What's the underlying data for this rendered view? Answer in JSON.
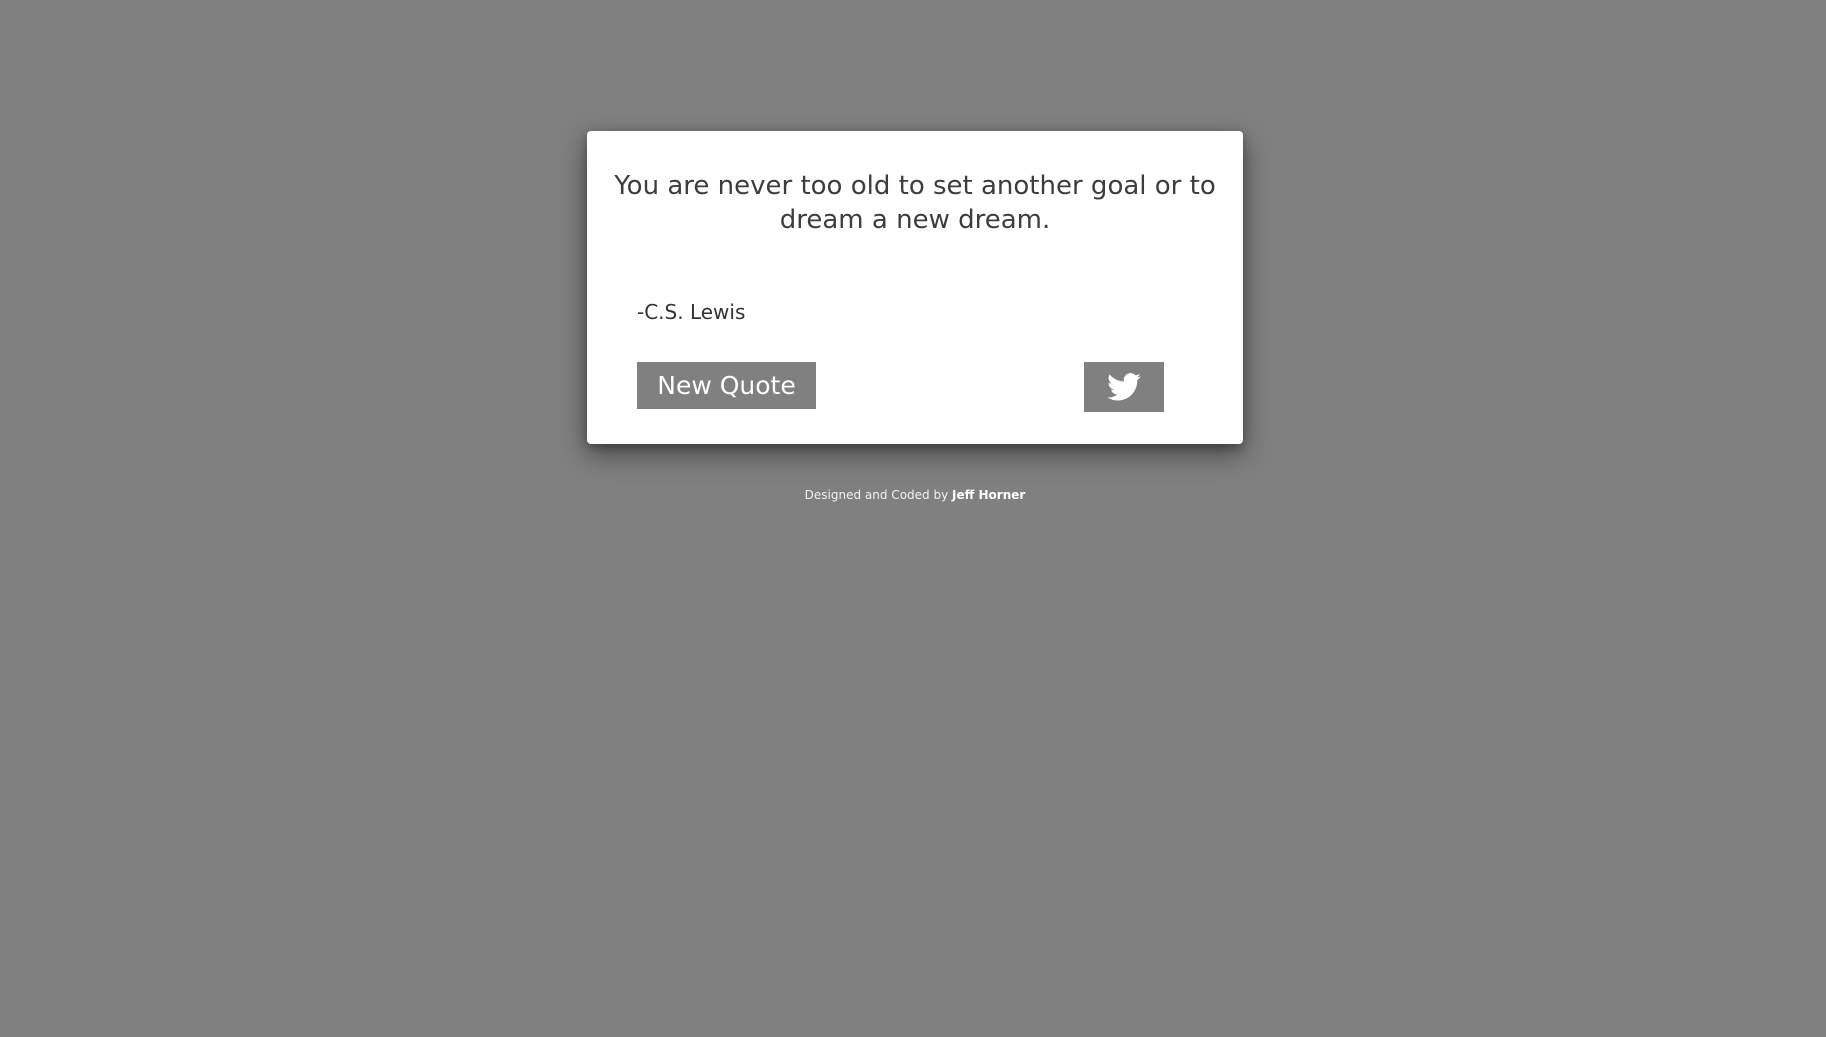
{
  "quote": {
    "text": "You are never too old to set another goal or to dream a new dream.",
    "author": "-C.S. Lewis"
  },
  "buttons": {
    "new_quote_label": "New Quote",
    "tweet_icon": "twitter-bird-icon"
  },
  "footer": {
    "prefix": "Designed and Coded by",
    "author": "Jeff Horner"
  },
  "colors": {
    "background": "#808080",
    "card": "#ffffff",
    "button": "#808080",
    "button_text": "#ffffff",
    "quote_text": "#3d3d3d"
  }
}
